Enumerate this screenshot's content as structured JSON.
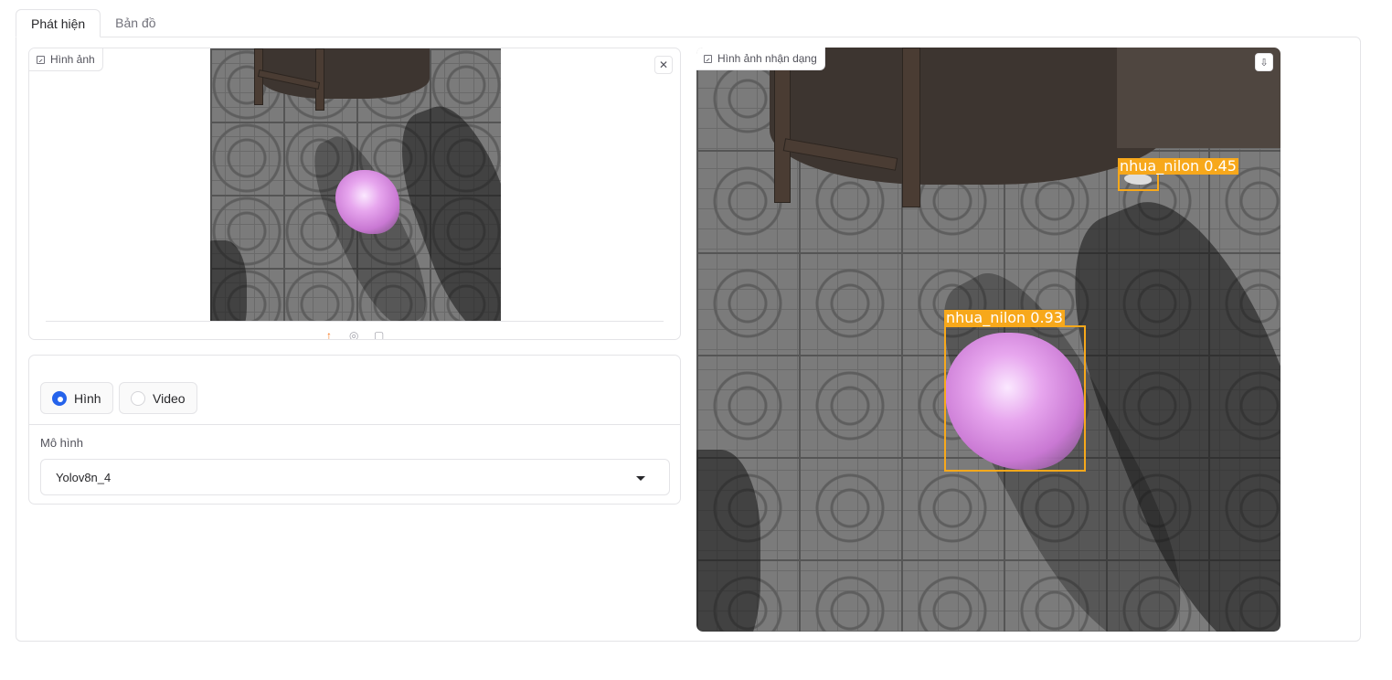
{
  "tabs": [
    {
      "label": "Phát hiện",
      "active": true
    },
    {
      "label": "Bản đồ",
      "active": false
    }
  ],
  "input_image": {
    "label": "Hình ảnh",
    "icons": [
      "image-icon",
      "close-icon",
      "upload-icon",
      "webcam-icon",
      "clipboard-icon"
    ]
  },
  "media_type": {
    "options": [
      {
        "label": "Hình",
        "selected": true
      },
      {
        "label": "Video",
        "selected": false
      }
    ]
  },
  "model": {
    "label": "Mô hình",
    "selected": "Yolov8n_4"
  },
  "output_image": {
    "label": "Hình ảnh nhận dạng",
    "icons": [
      "image-icon",
      "download-icon"
    ],
    "detections": [
      {
        "label": "nhua_nilon 0.45",
        "class": "nhua_nilon",
        "confidence": 0.45
      },
      {
        "label": "nhua_nilon 0.93",
        "class": "nhua_nilon",
        "confidence": 0.93
      }
    ]
  },
  "colors": {
    "accent": "#2563eb",
    "detection_box": "#f7a81b",
    "upload_accent": "#f97316"
  }
}
